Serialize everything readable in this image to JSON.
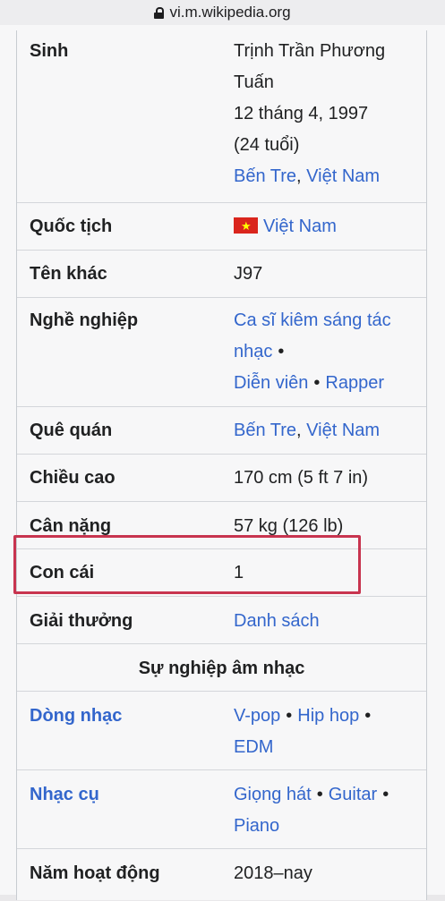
{
  "browser": {
    "url": "vi.m.wikipedia.org"
  },
  "infobox": {
    "born": {
      "label": "Sinh",
      "name_line1": "Trịnh Trần Phương",
      "name_line2": "Tuấn",
      "date": "12 tháng 4, 1997",
      "age": "(24 tuổi)",
      "place_1": "Bến Tre",
      "place_sep": ",",
      "place_2": "Việt Nam"
    },
    "nationality": {
      "label": "Quốc tịch",
      "value": "Việt Nam",
      "flag_icon": "vietnam-flag-icon"
    },
    "other_names": {
      "label": "Tên khác",
      "value": "J97"
    },
    "occupation": {
      "label": "Nghề nghiệp",
      "item_1_line1": "Ca sĩ kiêm sáng tác",
      "item_1_line2": "nhạc",
      "item_2": "Diễn viên",
      "item_3": "Rapper",
      "separator": "•"
    },
    "hometown": {
      "label": "Quê quán",
      "place_1": "Bến Tre",
      "place_sep": ",",
      "place_2": "Việt Nam"
    },
    "height": {
      "label": "Chiều cao",
      "value": "170 cm (5 ft 7 in)"
    },
    "weight": {
      "label": "Cân nặng",
      "value": "57 kg (126 lb)"
    },
    "children": {
      "label": "Con cái",
      "value": "1"
    },
    "awards": {
      "label": "Giải thưởng",
      "value": "Danh sách"
    },
    "music_career": {
      "heading": "Sự nghiệp âm nhạc"
    },
    "genre": {
      "label": "Dòng nhạc",
      "item_1": "V-pop",
      "item_2": "Hip hop",
      "item_3": "EDM",
      "separator": "•"
    },
    "instruments": {
      "label": "Nhạc cụ",
      "item_1": "Giọng hát",
      "item_2": "Guitar",
      "item_3": "Piano",
      "separator": "•"
    },
    "years_active": {
      "label": "Năm hoạt động",
      "value": "2018–nay"
    }
  },
  "colors": {
    "link": "#3366cc",
    "highlight_border": "#c8344f",
    "flag_red": "#da251d",
    "flag_star": "#ffff00"
  }
}
